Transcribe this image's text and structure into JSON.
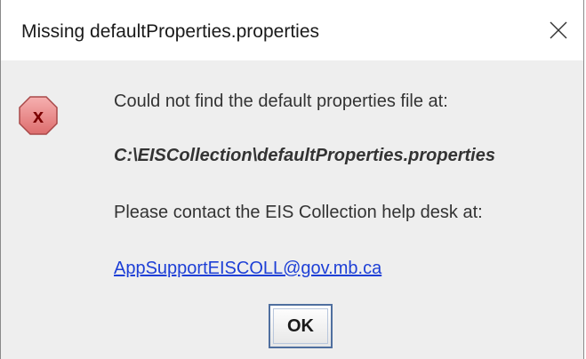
{
  "window": {
    "title": "Missing defaultProperties.properties"
  },
  "icons": {
    "close": "close-icon",
    "error": "error-icon"
  },
  "message": {
    "line1": "Could not find the default properties file at:",
    "path": "C:\\EISCollection\\defaultProperties.properties",
    "line3": "Please contact the EIS Collection help desk at:",
    "email": "AppSupportEISCOLL@gov.mb.ca"
  },
  "buttons": {
    "ok_label": "OK"
  },
  "colors": {
    "background": "#eeeeee",
    "titlebar": "#ffffff",
    "link": "#1d3fd6",
    "error_fill": "#e98080",
    "error_mark": "#8b0000"
  }
}
